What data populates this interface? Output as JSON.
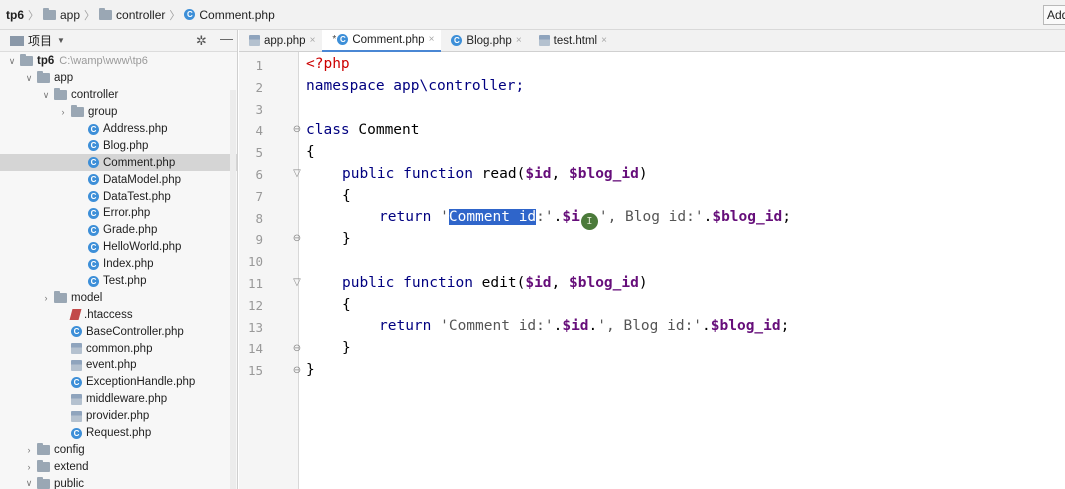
{
  "breadcrumb": [
    {
      "label": "tp6",
      "icon": "folder-icon",
      "bold": true
    },
    {
      "label": "app",
      "icon": "folder-icon"
    },
    {
      "label": "controller",
      "icon": "folder-icon"
    },
    {
      "label": "Comment.php",
      "icon": "php-class-icon"
    }
  ],
  "toolbar": {
    "add_label": "Add"
  },
  "panel": {
    "title": "项目"
  },
  "tree": [
    {
      "label": "tp6",
      "hint": "C:\\wamp\\www\\tp6",
      "type": "folder",
      "depth": 0,
      "arrow": "v",
      "bold": true
    },
    {
      "label": "app",
      "type": "folder",
      "depth": 1,
      "arrow": "v"
    },
    {
      "label": "controller",
      "type": "folder",
      "depth": 2,
      "arrow": "v"
    },
    {
      "label": "group",
      "type": "folder",
      "depth": 3,
      "arrow": ">"
    },
    {
      "label": "Address.php",
      "type": "class",
      "depth": 4
    },
    {
      "label": "Blog.php",
      "type": "class",
      "depth": 4
    },
    {
      "label": "Comment.php",
      "type": "class",
      "depth": 4,
      "selected": true
    },
    {
      "label": "DataModel.php",
      "type": "class",
      "depth": 4
    },
    {
      "label": "DataTest.php",
      "type": "class",
      "depth": 4
    },
    {
      "label": "Error.php",
      "type": "class",
      "depth": 4
    },
    {
      "label": "Grade.php",
      "type": "class",
      "depth": 4
    },
    {
      "label": "HelloWorld.php",
      "type": "class",
      "depth": 4
    },
    {
      "label": "Index.php",
      "type": "class",
      "depth": 4
    },
    {
      "label": "Test.php",
      "type": "class",
      "depth": 4
    },
    {
      "label": "model",
      "type": "folder",
      "depth": 2,
      "arrow": ">"
    },
    {
      "label": ".htaccess",
      "type": "htaccess",
      "depth": 3
    },
    {
      "label": "BaseController.php",
      "type": "class",
      "depth": 3
    },
    {
      "label": "common.php",
      "type": "config",
      "depth": 3
    },
    {
      "label": "event.php",
      "type": "config",
      "depth": 3
    },
    {
      "label": "ExceptionHandle.php",
      "type": "class",
      "depth": 3
    },
    {
      "label": "middleware.php",
      "type": "config",
      "depth": 3
    },
    {
      "label": "provider.php",
      "type": "config",
      "depth": 3
    },
    {
      "label": "Request.php",
      "type": "class",
      "depth": 3
    },
    {
      "label": "config",
      "type": "folder",
      "depth": 1,
      "arrow": ">"
    },
    {
      "label": "extend",
      "type": "folder",
      "depth": 1,
      "arrow": ">"
    },
    {
      "label": "public",
      "type": "folder",
      "depth": 1,
      "arrow": "v"
    }
  ],
  "tabs": [
    {
      "label": "app.php",
      "icon": "php-config-icon",
      "active": false,
      "modified": false
    },
    {
      "label": "Comment.php",
      "icon": "php-class-icon",
      "active": true,
      "modified": true
    },
    {
      "label": "Blog.php",
      "icon": "php-class-icon",
      "active": false,
      "modified": false
    },
    {
      "label": "test.html",
      "icon": "html-file-icon",
      "active": false,
      "modified": false
    }
  ],
  "editor": {
    "line_numbers": [
      "1",
      "2",
      "3",
      "4",
      "5",
      "6",
      "7",
      "8",
      "9",
      "10",
      "11",
      "12",
      "13",
      "14",
      "15"
    ],
    "lines": {
      "l1": "<?php",
      "l2": "namespace app\\controller;",
      "l4_kw": "class",
      "l4_name": " Comment",
      "l5": "{",
      "l6_kw": "public function",
      "l6_rest": " read(",
      "l6_v1": "$id",
      "l6_sep": ", ",
      "l6_v2": "$blog_id",
      "l6_end": ")",
      "l7": "{",
      "l8_kw": "return",
      "l8_q1": " '",
      "l8_sel": "Comment id",
      "l8_after": ":'",
      "l8_dot": ".",
      "l8_var": "$i",
      "l8_cursor": "I",
      "l8_str2": "', Blog id:'",
      "l8_dot2": ".",
      "l8_var2": "$blog_id",
      "l8_semi": ";",
      "l9": "}",
      "l11_kw": "public function",
      "l11_rest": " edit(",
      "l11_v1": "$id",
      "l11_sep": ", ",
      "l11_v2": "$blog_id",
      "l11_end": ")",
      "l12": "{",
      "l13_kw": "return",
      "l13_str": " 'Comment id:'",
      "l13_dot": ".",
      "l13_var": "$id",
      "l13_dot2": ".",
      "l13_str2": "', Blog id:'",
      "l13_dot3": ".",
      "l13_var2": "$blog_id",
      "l13_semi": ";",
      "l14": "}",
      "l15": "}"
    }
  },
  "colors": {
    "keyword": "#000080",
    "variable": "#660e7a",
    "php_tag": "#cc0000",
    "selection": "#2f65ca",
    "class_icon": "#3d8fd8"
  }
}
